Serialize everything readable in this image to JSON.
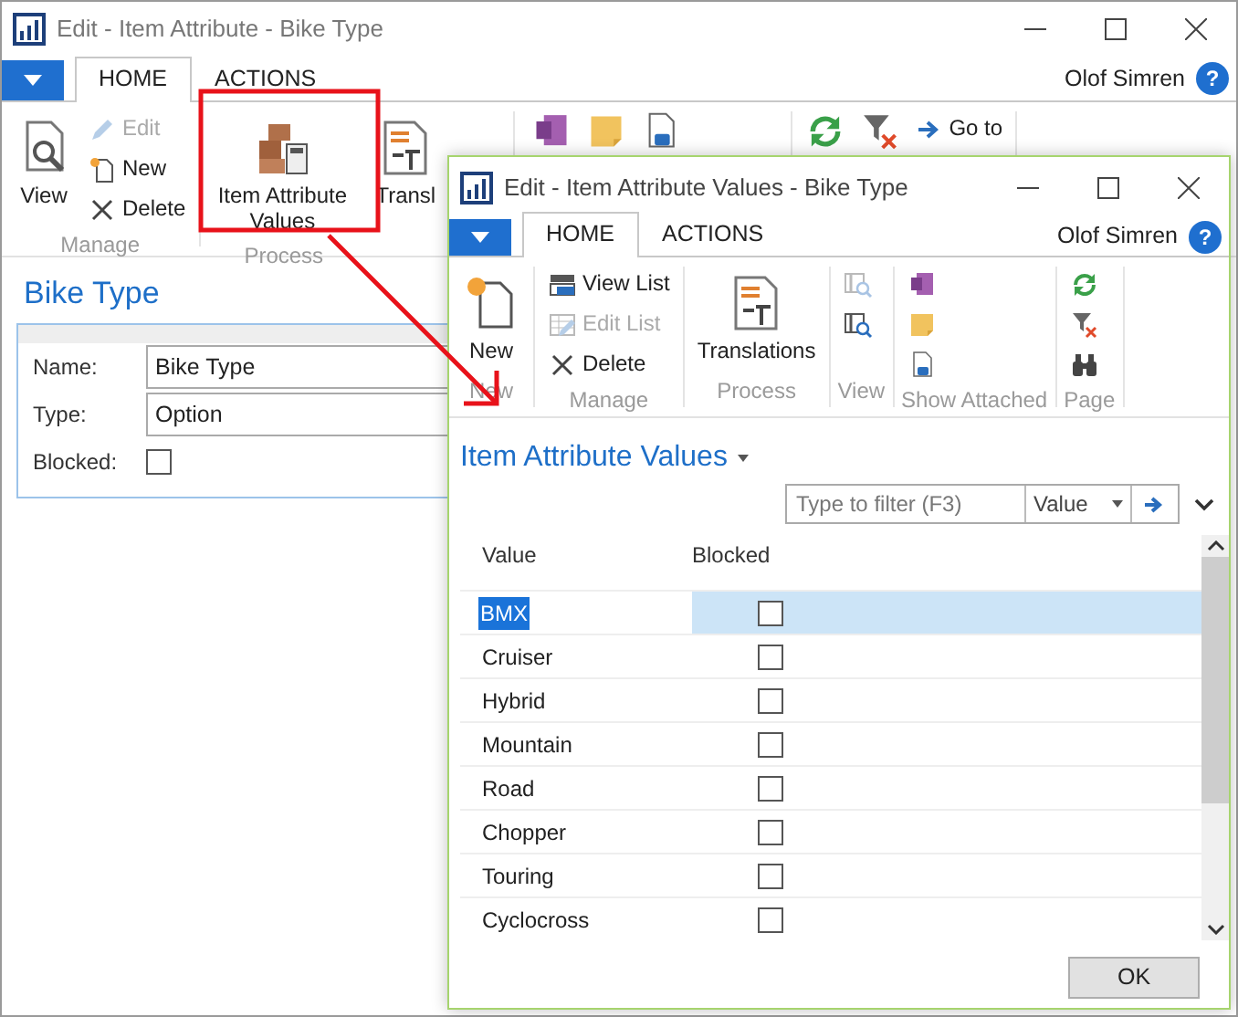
{
  "back_window": {
    "title": "Edit - Item Attribute - Bike Type",
    "tabs": [
      {
        "label": "HOME",
        "selected": true
      },
      {
        "label": "ACTIONS",
        "selected": false
      }
    ],
    "user": "Olof Simren",
    "help": "?",
    "ribbon": [
      {
        "label": "Manage",
        "large": [
          {
            "kind": "view",
            "label": "View",
            "disabled": false
          }
        ],
        "small": [
          {
            "kind": "edit",
            "label": "Edit",
            "disabled": true
          },
          {
            "kind": "new",
            "label": "New",
            "disabled": false
          },
          {
            "kind": "delete",
            "label": "Delete",
            "disabled": false
          }
        ]
      },
      {
        "label": "Process",
        "large": [
          {
            "kind": "attributes",
            "label": "Item Attribute Values",
            "disabled": false
          },
          {
            "kind": "translate",
            "label": "Transl",
            "disabled": false
          }
        ]
      },
      {
        "large": [
          {
            "kind": "onenote",
            "disabled": false
          },
          {
            "kind": "note",
            "disabled": false
          },
          {
            "kind": "link",
            "disabled": false
          }
        ]
      },
      {
        "large": [
          {
            "kind": "refresh",
            "disabled": false
          },
          {
            "kind": "clear-filter",
            "disabled": false
          }
        ],
        "small": [
          {
            "kind": "goto",
            "label": "Go to",
            "disabled": false
          }
        ]
      }
    ],
    "heading": "Bike Type",
    "fields": [
      {
        "kind": "text",
        "label": "Name:",
        "value": "Bike Type"
      },
      {
        "kind": "text",
        "label": "Type:",
        "value": "Option"
      },
      {
        "kind": "checkbox",
        "label": "Blocked:",
        "checked": false
      }
    ]
  },
  "front_window": {
    "title": "Edit - Item Attribute Values - Bike Type",
    "tabs": [
      {
        "label": "HOME",
        "selected": true
      },
      {
        "label": "ACTIONS",
        "selected": false
      }
    ],
    "user": "Olof Simren",
    "help": "?",
    "ribbon": [
      {
        "label": "New",
        "large": [
          {
            "kind": "new-page",
            "label": "New",
            "disabled": false
          }
        ]
      },
      {
        "label": "Manage",
        "small": [
          {
            "kind": "view-list",
            "label": "View List",
            "disabled": false
          },
          {
            "kind": "edit-list",
            "label": "Edit List",
            "disabled": true
          },
          {
            "kind": "delete",
            "label": "Delete",
            "disabled": false
          }
        ]
      },
      {
        "label": "Process",
        "large": [
          {
            "kind": "translate",
            "label": "Translations",
            "disabled": false
          }
        ]
      },
      {
        "label": "View",
        "small": [
          {
            "kind": "view-card",
            "disabled": true
          },
          {
            "kind": "view-card",
            "disabled": false
          }
        ]
      },
      {
        "label": "Show Attached",
        "small": [
          {
            "kind": "onenote",
            "disabled": false
          },
          {
            "kind": "note",
            "disabled": false
          },
          {
            "kind": "link",
            "disabled": false
          }
        ]
      },
      {
        "label": "Page",
        "small": [
          {
            "kind": "refresh",
            "disabled": false
          },
          {
            "kind": "clear-filter",
            "disabled": false
          },
          {
            "kind": "find",
            "disabled": false
          }
        ]
      }
    ],
    "list_title": "Item Attribute Values",
    "filter": {
      "placeholder": "Type to filter (F3)",
      "field": "Value"
    },
    "columns": [
      "Value",
      "Blocked"
    ],
    "rows": [
      {
        "value": "BMX",
        "blocked": false,
        "selected": true
      },
      {
        "value": "Cruiser",
        "blocked": false,
        "selected": false
      },
      {
        "value": "Hybrid",
        "blocked": false,
        "selected": false
      },
      {
        "value": "Mountain",
        "blocked": false,
        "selected": false
      },
      {
        "value": "Road",
        "blocked": false,
        "selected": false
      },
      {
        "value": "Chopper",
        "blocked": false,
        "selected": false
      },
      {
        "value": "Touring",
        "blocked": false,
        "selected": false
      },
      {
        "value": "Cyclocross",
        "blocked": false,
        "selected": false
      }
    ],
    "ok_button": "OK"
  }
}
